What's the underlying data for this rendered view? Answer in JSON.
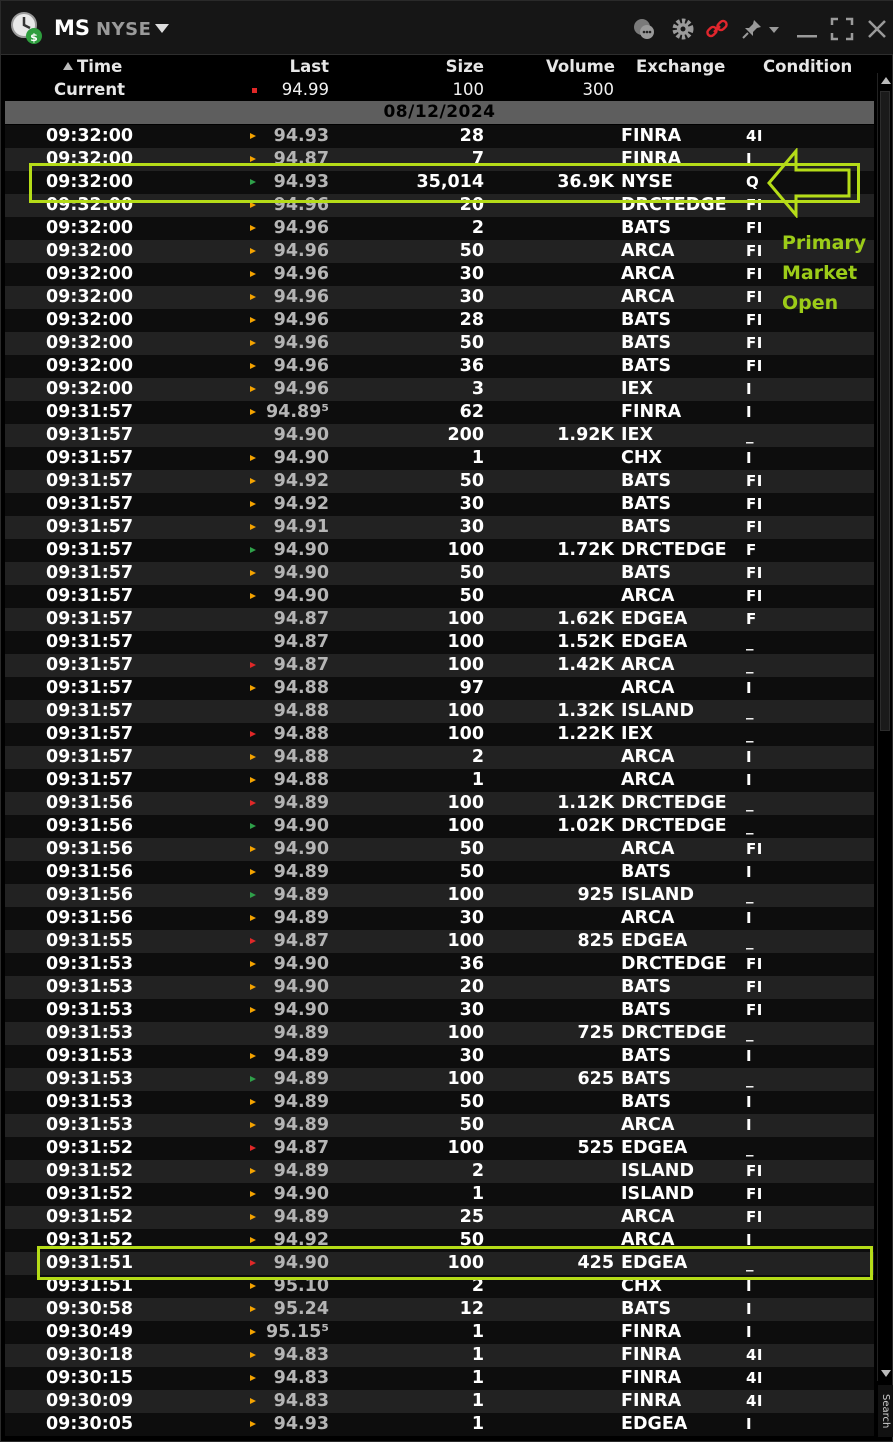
{
  "title_bar": {
    "symbol": "MS",
    "exchange": "NYSE",
    "icons": [
      "app-logo-icon",
      "chat-icon",
      "gear-icon",
      "link-icon",
      "pin-icon",
      "minimize-icon",
      "maximize-icon",
      "close-icon"
    ]
  },
  "columns": {
    "time": "Time",
    "last": "Last",
    "size": "Size",
    "volume": "Volume",
    "exchange": "Exchange",
    "condition": "Condition"
  },
  "current": {
    "label": "Current",
    "last": "94.99",
    "size": "100",
    "volume": "300"
  },
  "date": "08/12/2024",
  "annotation": {
    "line1": "Primary",
    "line2": "Market",
    "line3": "Open"
  },
  "search_tab": "Search",
  "colors": {
    "tick_orange": "#f4a300",
    "tick_green": "#2fa04a",
    "tick_red": "#e02828",
    "highlight": "#b5dc18"
  },
  "rows": [
    {
      "time": "09:32:00",
      "tick": "orange",
      "last": "94.93",
      "size": "28",
      "volume": "",
      "exchange": "FINRA",
      "condition": "4I"
    },
    {
      "time": "09:32:00",
      "tick": "orange",
      "last": "94.87",
      "size": "7",
      "volume": "",
      "exchange": "FINRA",
      "condition": "I"
    },
    {
      "time": "09:32:00",
      "tick": "green",
      "last": "94.93",
      "size": "35,014",
      "volume": "36.9K",
      "exchange": "NYSE",
      "condition": "Q"
    },
    {
      "time": "09:32:00",
      "tick": "orange",
      "last": "94.96",
      "size": "20",
      "volume": "",
      "exchange": "DRCTEDGE",
      "condition": "FI"
    },
    {
      "time": "09:32:00",
      "tick": "orange",
      "last": "94.96",
      "size": "2",
      "volume": "",
      "exchange": "BATS",
      "condition": "FI"
    },
    {
      "time": "09:32:00",
      "tick": "orange",
      "last": "94.96",
      "size": "50",
      "volume": "",
      "exchange": "ARCA",
      "condition": "FI"
    },
    {
      "time": "09:32:00",
      "tick": "orange",
      "last": "94.96",
      "size": "30",
      "volume": "",
      "exchange": "ARCA",
      "condition": "FI"
    },
    {
      "time": "09:32:00",
      "tick": "orange",
      "last": "94.96",
      "size": "30",
      "volume": "",
      "exchange": "ARCA",
      "condition": "FI"
    },
    {
      "time": "09:32:00",
      "tick": "orange",
      "last": "94.96",
      "size": "28",
      "volume": "",
      "exchange": "BATS",
      "condition": "FI"
    },
    {
      "time": "09:32:00",
      "tick": "orange",
      "last": "94.96",
      "size": "50",
      "volume": "",
      "exchange": "BATS",
      "condition": "FI"
    },
    {
      "time": "09:32:00",
      "tick": "orange",
      "last": "94.96",
      "size": "36",
      "volume": "",
      "exchange": "BATS",
      "condition": "FI"
    },
    {
      "time": "09:32:00",
      "tick": "orange",
      "last": "94.96",
      "size": "3",
      "volume": "",
      "exchange": "IEX",
      "condition": "I"
    },
    {
      "time": "09:31:57",
      "tick": "orange",
      "last": "94.89⁵",
      "size": "62",
      "volume": "",
      "exchange": "FINRA",
      "condition": "I"
    },
    {
      "time": "09:31:57",
      "tick": "none",
      "last": "94.90",
      "size": "200",
      "volume": "1.92K",
      "exchange": "IEX",
      "condition": "_"
    },
    {
      "time": "09:31:57",
      "tick": "orange",
      "last": "94.90",
      "size": "1",
      "volume": "",
      "exchange": "CHX",
      "condition": "I"
    },
    {
      "time": "09:31:57",
      "tick": "orange",
      "last": "94.92",
      "size": "50",
      "volume": "",
      "exchange": "BATS",
      "condition": "FI"
    },
    {
      "time": "09:31:57",
      "tick": "orange",
      "last": "94.92",
      "size": "30",
      "volume": "",
      "exchange": "BATS",
      "condition": "FI"
    },
    {
      "time": "09:31:57",
      "tick": "orange",
      "last": "94.91",
      "size": "30",
      "volume": "",
      "exchange": "BATS",
      "condition": "FI"
    },
    {
      "time": "09:31:57",
      "tick": "green",
      "last": "94.90",
      "size": "100",
      "volume": "1.72K",
      "exchange": "DRCTEDGE",
      "condition": "F"
    },
    {
      "time": "09:31:57",
      "tick": "orange",
      "last": "94.90",
      "size": "50",
      "volume": "",
      "exchange": "BATS",
      "condition": "FI"
    },
    {
      "time": "09:31:57",
      "tick": "orange",
      "last": "94.90",
      "size": "50",
      "volume": "",
      "exchange": "ARCA",
      "condition": "FI"
    },
    {
      "time": "09:31:57",
      "tick": "none",
      "last": "94.87",
      "size": "100",
      "volume": "1.62K",
      "exchange": "EDGEA",
      "condition": "F"
    },
    {
      "time": "09:31:57",
      "tick": "none",
      "last": "94.87",
      "size": "100",
      "volume": "1.52K",
      "exchange": "EDGEA",
      "condition": "_"
    },
    {
      "time": "09:31:57",
      "tick": "red",
      "last": "94.87",
      "size": "100",
      "volume": "1.42K",
      "exchange": "ARCA",
      "condition": "_"
    },
    {
      "time": "09:31:57",
      "tick": "orange",
      "last": "94.88",
      "size": "97",
      "volume": "",
      "exchange": "ARCA",
      "condition": "I"
    },
    {
      "time": "09:31:57",
      "tick": "none",
      "last": "94.88",
      "size": "100",
      "volume": "1.32K",
      "exchange": "ISLAND",
      "condition": "_"
    },
    {
      "time": "09:31:57",
      "tick": "red",
      "last": "94.88",
      "size": "100",
      "volume": "1.22K",
      "exchange": "IEX",
      "condition": "_"
    },
    {
      "time": "09:31:57",
      "tick": "orange",
      "last": "94.88",
      "size": "2",
      "volume": "",
      "exchange": "ARCA",
      "condition": "I"
    },
    {
      "time": "09:31:57",
      "tick": "orange",
      "last": "94.88",
      "size": "1",
      "volume": "",
      "exchange": "ARCA",
      "condition": "I"
    },
    {
      "time": "09:31:56",
      "tick": "red",
      "last": "94.89",
      "size": "100",
      "volume": "1.12K",
      "exchange": "DRCTEDGE",
      "condition": "_"
    },
    {
      "time": "09:31:56",
      "tick": "green",
      "last": "94.90",
      "size": "100",
      "volume": "1.02K",
      "exchange": "DRCTEDGE",
      "condition": "_"
    },
    {
      "time": "09:31:56",
      "tick": "orange",
      "last": "94.90",
      "size": "50",
      "volume": "",
      "exchange": "ARCA",
      "condition": "FI"
    },
    {
      "time": "09:31:56",
      "tick": "orange",
      "last": "94.89",
      "size": "50",
      "volume": "",
      "exchange": "BATS",
      "condition": "I"
    },
    {
      "time": "09:31:56",
      "tick": "green",
      "last": "94.89",
      "size": "100",
      "volume": "925",
      "exchange": "ISLAND",
      "condition": "_"
    },
    {
      "time": "09:31:56",
      "tick": "orange",
      "last": "94.89",
      "size": "30",
      "volume": "",
      "exchange": "ARCA",
      "condition": "I"
    },
    {
      "time": "09:31:55",
      "tick": "red",
      "last": "94.87",
      "size": "100",
      "volume": "825",
      "exchange": "EDGEA",
      "condition": "_"
    },
    {
      "time": "09:31:53",
      "tick": "orange",
      "last": "94.90",
      "size": "36",
      "volume": "",
      "exchange": "DRCTEDGE",
      "condition": "FI"
    },
    {
      "time": "09:31:53",
      "tick": "orange",
      "last": "94.90",
      "size": "20",
      "volume": "",
      "exchange": "BATS",
      "condition": "FI"
    },
    {
      "time": "09:31:53",
      "tick": "orange",
      "last": "94.90",
      "size": "30",
      "volume": "",
      "exchange": "BATS",
      "condition": "FI"
    },
    {
      "time": "09:31:53",
      "tick": "none",
      "last": "94.89",
      "size": "100",
      "volume": "725",
      "exchange": "DRCTEDGE",
      "condition": "_"
    },
    {
      "time": "09:31:53",
      "tick": "orange",
      "last": "94.89",
      "size": "30",
      "volume": "",
      "exchange": "BATS",
      "condition": "I"
    },
    {
      "time": "09:31:53",
      "tick": "green",
      "last": "94.89",
      "size": "100",
      "volume": "625",
      "exchange": "BATS",
      "condition": "_"
    },
    {
      "time": "09:31:53",
      "tick": "orange",
      "last": "94.89",
      "size": "50",
      "volume": "",
      "exchange": "BATS",
      "condition": "I"
    },
    {
      "time": "09:31:53",
      "tick": "orange",
      "last": "94.89",
      "size": "50",
      "volume": "",
      "exchange": "ARCA",
      "condition": "I"
    },
    {
      "time": "09:31:52",
      "tick": "red",
      "last": "94.87",
      "size": "100",
      "volume": "525",
      "exchange": "EDGEA",
      "condition": "_"
    },
    {
      "time": "09:31:52",
      "tick": "orange",
      "last": "94.89",
      "size": "2",
      "volume": "",
      "exchange": "ISLAND",
      "condition": "FI"
    },
    {
      "time": "09:31:52",
      "tick": "orange",
      "last": "94.90",
      "size": "1",
      "volume": "",
      "exchange": "ISLAND",
      "condition": "FI"
    },
    {
      "time": "09:31:52",
      "tick": "orange",
      "last": "94.89",
      "size": "25",
      "volume": "",
      "exchange": "ARCA",
      "condition": "FI"
    },
    {
      "time": "09:31:52",
      "tick": "orange",
      "last": "94.92",
      "size": "50",
      "volume": "",
      "exchange": "ARCA",
      "condition": "I"
    },
    {
      "time": "09:31:51",
      "tick": "red",
      "last": "94.90",
      "size": "100",
      "volume": "425",
      "exchange": "EDGEA",
      "condition": "_"
    },
    {
      "time": "09:31:51",
      "tick": "orange",
      "last": "95.10",
      "size": "2",
      "volume": "",
      "exchange": "CHX",
      "condition": "I"
    },
    {
      "time": "09:30:58",
      "tick": "orange",
      "last": "95.24",
      "size": "12",
      "volume": "",
      "exchange": "BATS",
      "condition": "I"
    },
    {
      "time": "09:30:49",
      "tick": "orange",
      "last": "95.15⁵",
      "size": "1",
      "volume": "",
      "exchange": "FINRA",
      "condition": "I"
    },
    {
      "time": "09:30:18",
      "tick": "orange",
      "last": "94.83",
      "size": "1",
      "volume": "",
      "exchange": "FINRA",
      "condition": "4I"
    },
    {
      "time": "09:30:15",
      "tick": "orange",
      "last": "94.83",
      "size": "1",
      "volume": "",
      "exchange": "FINRA",
      "condition": "4I"
    },
    {
      "time": "09:30:09",
      "tick": "orange",
      "last": "94.83",
      "size": "1",
      "volume": "",
      "exchange": "FINRA",
      "condition": "4I"
    },
    {
      "time": "09:30:05",
      "tick": "orange",
      "last": "94.93",
      "size": "1",
      "volume": "",
      "exchange": "EDGEA",
      "condition": "I"
    }
  ]
}
